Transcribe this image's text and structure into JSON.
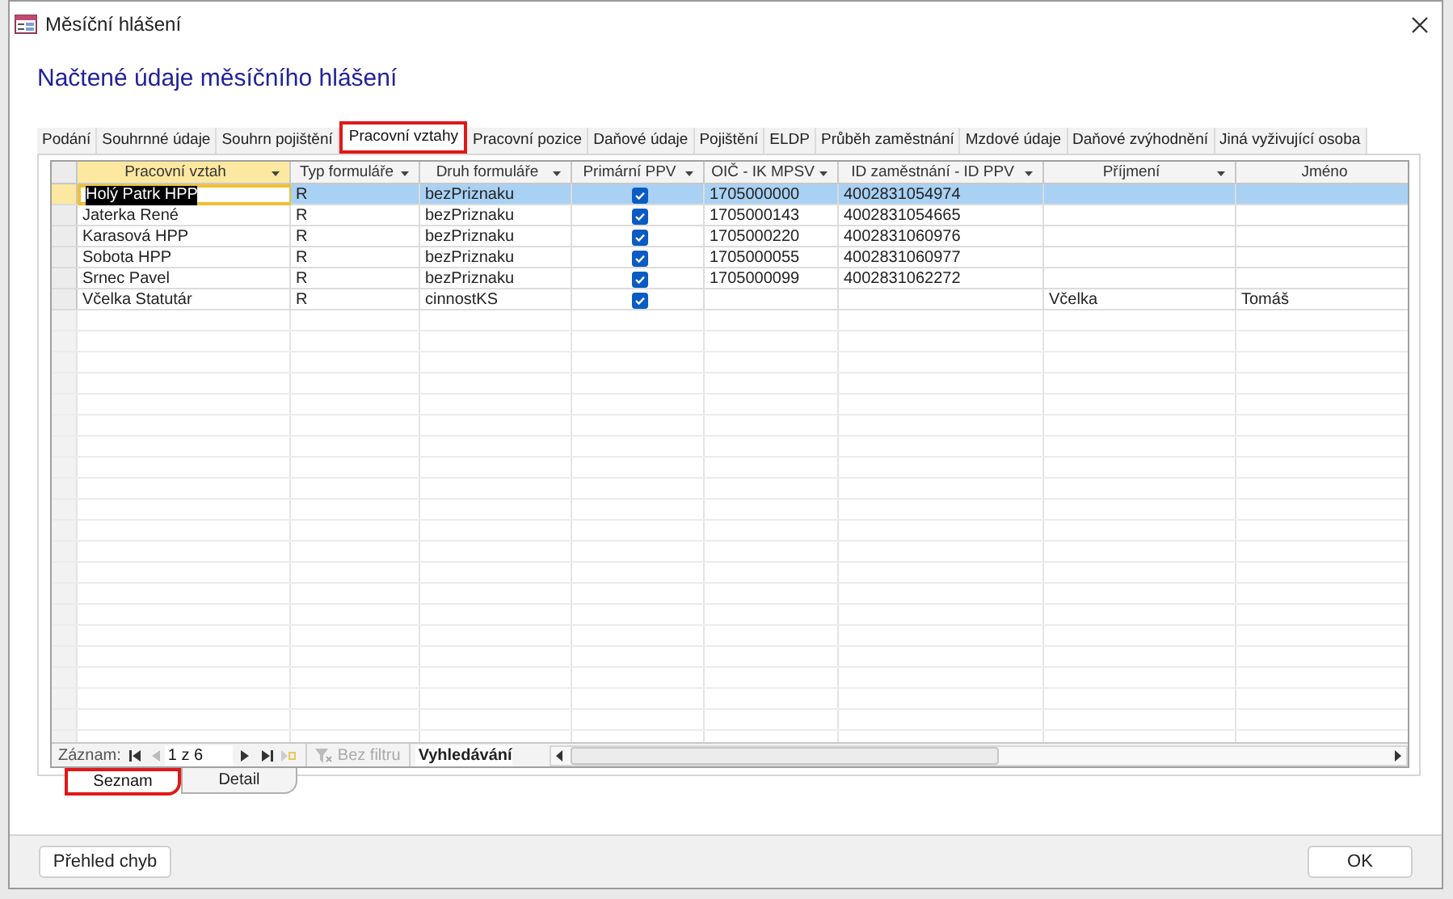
{
  "window": {
    "title": "Měsíční hlášení"
  },
  "heading": "Načtené údaje měsíčního hlášení",
  "tabs": [
    {
      "label": "Podání",
      "selected": false
    },
    {
      "label": "Souhrnné údaje",
      "selected": false
    },
    {
      "label": "Souhrn pojištění",
      "selected": false
    },
    {
      "label": "Pracovní vztahy",
      "selected": true
    },
    {
      "label": "Pracovní pozice",
      "selected": false
    },
    {
      "label": "Daňové údaje",
      "selected": false
    },
    {
      "label": "Pojištění",
      "selected": false
    },
    {
      "label": "ELDP",
      "selected": false
    },
    {
      "label": "Průběh zaměstnání",
      "selected": false
    },
    {
      "label": "Mzdové údaje",
      "selected": false
    },
    {
      "label": "Daňové zvýhodnění",
      "selected": false
    },
    {
      "label": "Jiná vyživující osoba",
      "selected": false
    }
  ],
  "table": {
    "columns": [
      {
        "label": "Pracovní vztah",
        "kind": "text"
      },
      {
        "label": "Typ formuláře",
        "kind": "text"
      },
      {
        "label": "Druh formuláře",
        "kind": "text"
      },
      {
        "label": "Primární PPV",
        "kind": "checkbox"
      },
      {
        "label": "OIČ - IK MPSV",
        "kind": "text"
      },
      {
        "label": "ID zaměstnání - ID PPV",
        "kind": "text"
      },
      {
        "label": "Příjmení",
        "kind": "text"
      },
      {
        "label": "Jméno",
        "kind": "text"
      }
    ],
    "rows": [
      {
        "selected": true,
        "cells": [
          {
            "text": "Holý Patrk HPP",
            "focused": true
          },
          {
            "text": "R"
          },
          {
            "text": "bezPriznaku"
          },
          {
            "checked": true
          },
          {
            "text": "1705000000"
          },
          {
            "text": "4002831054974"
          },
          {},
          {}
        ]
      },
      {
        "selected": false,
        "cells": [
          {
            "text": "Jaterka René"
          },
          {
            "text": "R"
          },
          {
            "text": "bezPriznaku"
          },
          {
            "checked": true
          },
          {
            "text": "1705000143"
          },
          {
            "text": "4002831054665"
          },
          {},
          {}
        ]
      },
      {
        "selected": false,
        "cells": [
          {
            "text": "Karasová HPP"
          },
          {
            "text": "R"
          },
          {
            "text": "bezPriznaku"
          },
          {
            "checked": true
          },
          {
            "text": "1705000220"
          },
          {
            "text": "4002831060976"
          },
          {},
          {}
        ]
      },
      {
        "selected": false,
        "cells": [
          {
            "text": "Sobota HPP"
          },
          {
            "text": "R"
          },
          {
            "text": "bezPriznaku"
          },
          {
            "checked": true
          },
          {
            "text": "1705000055"
          },
          {
            "text": "4002831060977"
          },
          {},
          {}
        ]
      },
      {
        "selected": false,
        "cells": [
          {
            "text": "Srnec Pavel"
          },
          {
            "text": "R"
          },
          {
            "text": "bezPriznaku"
          },
          {
            "checked": true
          },
          {
            "text": "1705000099"
          },
          {
            "text": "4002831062272"
          },
          {},
          {}
        ]
      },
      {
        "selected": false,
        "cells": [
          {
            "text": "Včelka Statutár"
          },
          {
            "text": "R"
          },
          {
            "text": "cinnostKS"
          },
          {
            "checked": true
          },
          {},
          {},
          {
            "text": "Včelka"
          },
          {
            "text": "Tomáš"
          }
        ]
      }
    ]
  },
  "navigator": {
    "label": "Záznam:",
    "position": "1 z 6",
    "filter": "Bez filtru",
    "search": "Vyhledávání"
  },
  "view_tabs": [
    {
      "label": "Seznam",
      "selected": true
    },
    {
      "label": "Detail",
      "selected": false
    }
  ],
  "buttons": [
    {
      "label": "Přehled chyb"
    },
    {
      "label": "OK"
    }
  ]
}
